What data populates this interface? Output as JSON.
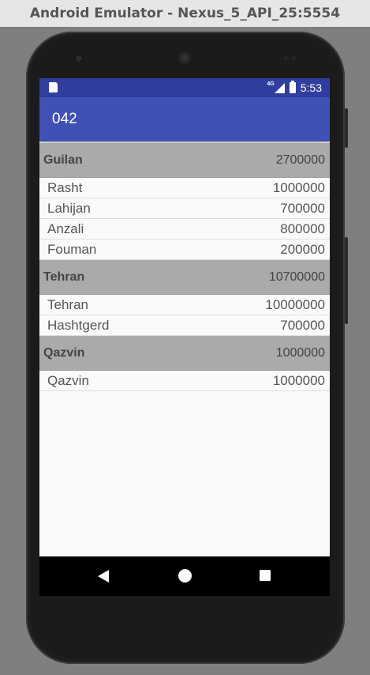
{
  "window": {
    "title": "Android Emulator - Nexus_5_API_25:5554"
  },
  "statusbar": {
    "network": "4G",
    "time": "5:53"
  },
  "appbar": {
    "title": "042"
  },
  "groups": [
    {
      "name": "Guilan",
      "total": "2700000",
      "items": [
        {
          "name": "Rasht",
          "value": "1000000"
        },
        {
          "name": "Lahijan",
          "value": "700000"
        },
        {
          "name": "Anzali",
          "value": "800000"
        },
        {
          "name": "Fouman",
          "value": "200000"
        }
      ]
    },
    {
      "name": "Tehran",
      "total": "10700000",
      "items": [
        {
          "name": "Tehran",
          "value": "10000000"
        },
        {
          "name": "Hashtgerd",
          "value": "700000"
        }
      ]
    },
    {
      "name": "Qazvin",
      "total": "1000000",
      "items": [
        {
          "name": "Qazvin",
          "value": "1000000"
        }
      ]
    }
  ],
  "navbar": {
    "icons": [
      "back-icon",
      "home-icon",
      "recents-icon"
    ]
  },
  "colors": {
    "statusbar": "#303f9f",
    "appbar": "#3f51b5",
    "group_header": "#aaaaaa"
  }
}
